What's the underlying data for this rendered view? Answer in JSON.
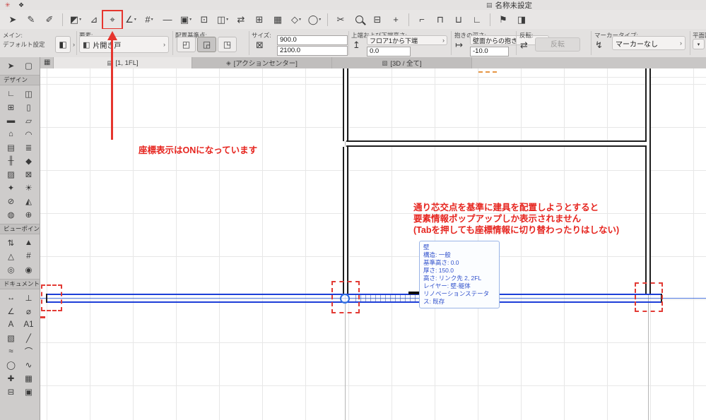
{
  "window": {
    "title": "名称未設定"
  },
  "titlebar": {
    "icons": [
      {
        "name": "app-badge",
        "glyph": "✳"
      },
      {
        "name": "edit-badge",
        "glyph": "❖"
      }
    ],
    "doc_icon": "▤"
  },
  "ui": {
    "chevron": "▾",
    "chevron_right": "›"
  },
  "toolbar": {
    "icons": [
      {
        "name": "cursor-tool",
        "glyph": "➤"
      },
      {
        "name": "pencil-tool",
        "glyph": "✎"
      },
      {
        "name": "pen-tool",
        "glyph": "✐"
      },
      {
        "sep": true
      },
      {
        "name": "selection-options",
        "glyph": "◩",
        "chevron": true
      },
      {
        "name": "snap-angle-toggle",
        "glyph": "⊿"
      },
      {
        "name": "coordinate-display-toggle",
        "glyph": "⌖",
        "highlighted": true
      },
      {
        "name": "tracker-options",
        "glyph": "∠",
        "chevron": true
      },
      {
        "name": "grid-snap-options",
        "glyph": "#",
        "chevron": true
      },
      {
        "name": "guide-line-toggle",
        "glyph": "—"
      },
      {
        "name": "attribute-options",
        "glyph": "▣",
        "chevron": true
      },
      {
        "name": "marquee-mode",
        "glyph": "⊡"
      },
      {
        "name": "layer-options",
        "glyph": "◫",
        "chevron": true
      },
      {
        "name": "transfer-settings",
        "glyph": "⇄"
      },
      {
        "name": "grid-toggle",
        "glyph": "⊞"
      },
      {
        "name": "fill-display-toggle",
        "glyph": "▦"
      },
      {
        "name": "shape-options",
        "glyph": "◇",
        "chevron": true
      },
      {
        "name": "circle-options",
        "glyph": "◯",
        "chevron": true
      },
      {
        "sep": true
      },
      {
        "name": "split-tool",
        "glyph": "✂"
      },
      {
        "name": "zoom-tool",
        "css": "mag"
      },
      {
        "name": "fit-view",
        "glyph": "⊟"
      },
      {
        "name": "pan-tool",
        "glyph": "+"
      },
      {
        "sep": true
      },
      {
        "name": "trim-tool",
        "glyph": "⌐"
      },
      {
        "name": "adjust-tool",
        "glyph": "⊓"
      },
      {
        "name": "intersect-tool",
        "glyph": "⊔"
      },
      {
        "name": "corner-tool",
        "glyph": "∟"
      },
      {
        "sep": true
      },
      {
        "name": "flag-tool",
        "glyph": "⚑"
      },
      {
        "name": "mirror-tool",
        "glyph": "◨"
      }
    ]
  },
  "infobar": {
    "main_label": "メイン:",
    "default_label": "デフォルト設定",
    "element_label": "要素:",
    "element_value": "片開き戸",
    "anchor_label": "配置基準点:",
    "anchor_options": [
      {
        "name": "anchor-side-left",
        "glyph": "◰"
      },
      {
        "name": "anchor-center",
        "glyph": "◲"
      },
      {
        "name": "anchor-side-right",
        "glyph": "◳"
      }
    ],
    "anchor_selected": 1,
    "size_label": "サイズ:",
    "size_width": "900.0",
    "size_height": "2100.0",
    "elevation_label": "上端および下端高さ:",
    "elevation_option": "フロア1から下端",
    "elevation_value": "0.0",
    "reveal_label": "抱きの深さ:",
    "reveal_option": "壁面からの抱き",
    "reveal_value": "-10.0",
    "flip_label": "反転:",
    "flip_button": "反転",
    "marker_label": "マーカータイプ:",
    "marker_value": "マーカーなし",
    "plan_label": "平面図",
    "icons": {
      "default": "◧",
      "element": "◧",
      "size": "⊠",
      "elevation": "↥",
      "reveal": "↦",
      "flip": "⇄",
      "marker": "↯"
    }
  },
  "tabs": {
    "overview_icon": "▦",
    "items": [
      {
        "icon": "▤",
        "label": "[1, 1FL]",
        "active": true
      },
      {
        "icon": "◈",
        "label": "[アクションセンター]",
        "active": false
      },
      {
        "icon": "▧",
        "label": "[3D / 全て]",
        "active": false
      }
    ]
  },
  "sidebar": {
    "sections": [
      {
        "id": "select",
        "label": "",
        "tools": [
          {
            "name": "arrow",
            "glyph": "➤"
          },
          {
            "name": "marquee",
            "glyph": "▢"
          }
        ]
      },
      {
        "id": "design",
        "label": "デザイン",
        "tools": [
          {
            "name": "wall",
            "glyph": "∟"
          },
          {
            "name": "door",
            "glyph": "◫"
          },
          {
            "name": "window",
            "glyph": "⊞"
          },
          {
            "name": "column",
            "glyph": "▯"
          },
          {
            "name": "beam",
            "glyph": "▬"
          },
          {
            "name": "slab",
            "glyph": "▱"
          },
          {
            "name": "roof",
            "glyph": "⌂"
          },
          {
            "name": "shell",
            "glyph": "◠"
          },
          {
            "name": "curtain-wall",
            "glyph": "▤"
          },
          {
            "name": "stair",
            "glyph": "≣"
          },
          {
            "name": "railing",
            "glyph": "╫"
          },
          {
            "name": "morph",
            "glyph": "◆"
          },
          {
            "name": "zone",
            "glyph": "▨"
          },
          {
            "name": "mesh",
            "glyph": "⊠"
          },
          {
            "name": "object",
            "glyph": "✦"
          },
          {
            "name": "lamp",
            "glyph": "☀"
          },
          {
            "name": "opening",
            "glyph": "⊘"
          },
          {
            "name": "truss",
            "glyph": "◭"
          },
          {
            "name": "skylight",
            "glyph": "◍"
          },
          {
            "name": "equipment",
            "glyph": "⊕"
          }
        ]
      },
      {
        "id": "viewpoint",
        "label": "ビューポイント",
        "tools": [
          {
            "name": "section",
            "glyph": "⇅"
          },
          {
            "name": "elevation",
            "glyph": "▲"
          },
          {
            "name": "interior-elevation",
            "glyph": "△"
          },
          {
            "name": "worksheet",
            "glyph": "#"
          },
          {
            "name": "detail",
            "glyph": "◎"
          },
          {
            "name": "camera",
            "glyph": "◉"
          }
        ]
      },
      {
        "id": "document",
        "label": "ドキュメント",
        "tools": [
          {
            "name": "dimension",
            "glyph": "↔"
          },
          {
            "name": "level-dimension",
            "glyph": "⊥"
          },
          {
            "name": "angle-dimension",
            "glyph": "∠"
          },
          {
            "name": "radial-dimension",
            "glyph": "⌀"
          },
          {
            "name": "text",
            "glyph": "A"
          },
          {
            "name": "label",
            "glyph": "A1"
          },
          {
            "name": "fill",
            "glyph": "▧"
          },
          {
            "name": "line",
            "glyph": "╱"
          },
          {
            "name": "polyline",
            "glyph": "≈"
          },
          {
            "name": "arc",
            "glyph": "⌒"
          },
          {
            "name": "circle",
            "glyph": "◯"
          },
          {
            "name": "spline",
            "glyph": "∿"
          },
          {
            "name": "hotspot",
            "glyph": "✚"
          },
          {
            "name": "figure",
            "glyph": "▦"
          },
          {
            "name": "drawing",
            "glyph": "⊟"
          },
          {
            "name": "stamp",
            "glyph": "▣"
          }
        ]
      }
    ]
  },
  "canvas": {
    "coord_note": "座標表示はONになっています",
    "popup_note_lines": [
      "通り芯交点を基準に建具を配置しようとすると",
      "要素情報ポップアップしか表示されません",
      "(Tabを押しても座標情報に切り替わったりはしない)"
    ],
    "tooltip": {
      "title": "壁",
      "lines": [
        "構造: 一般",
        "基準高さ: 0.0",
        "厚さ: 150.0",
        "高さ: リンク先 2, 2FL",
        "レイヤー: 壁-躯体",
        "リノベーションステータス: 既存"
      ]
    }
  },
  "colors": {
    "accent_red": "#e6352e",
    "wall_blue": "#1c3ed8",
    "tooltip_blue": "#3252cc"
  }
}
